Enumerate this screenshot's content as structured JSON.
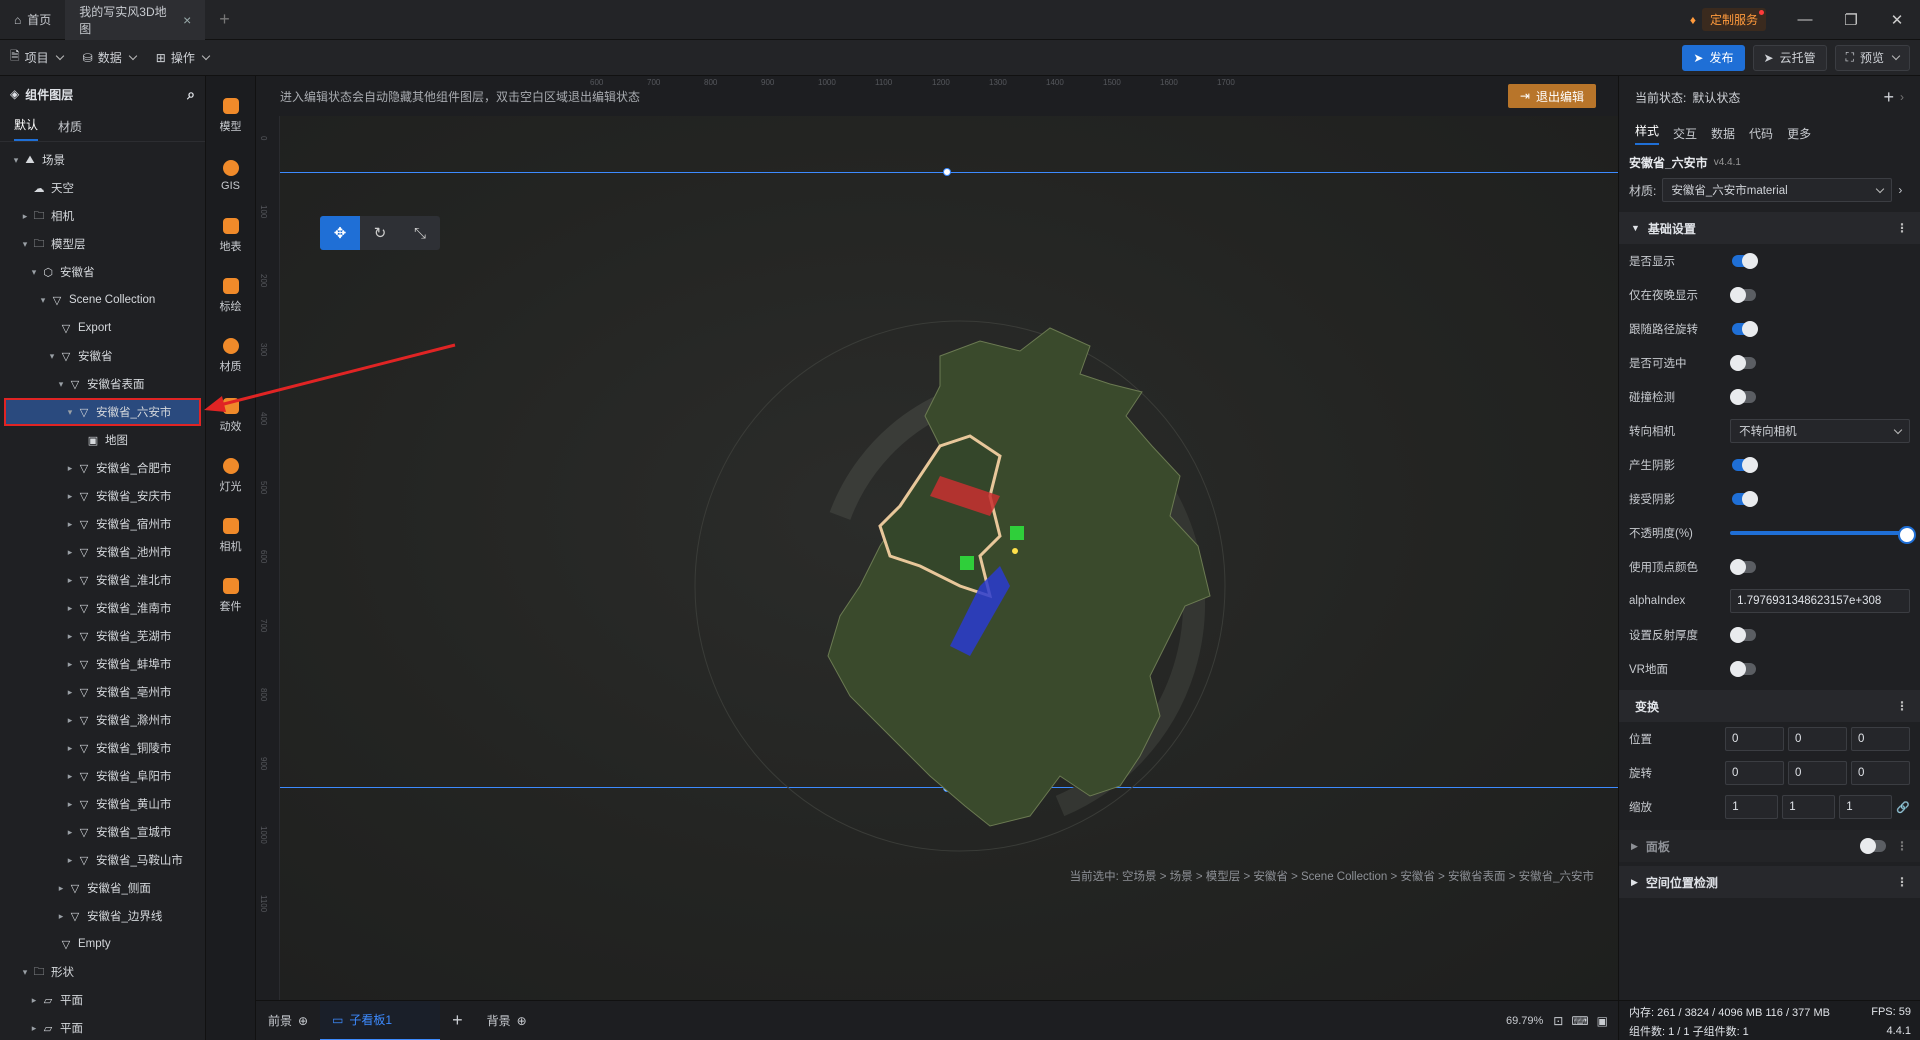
{
  "titlebar": {
    "home_tab": "首页",
    "doc_tab": "我的写实风3D地图",
    "custom_service": "定制服务"
  },
  "toolbar": {
    "menus": [
      "项目",
      "数据",
      "操作"
    ],
    "publish": "发布",
    "cloud_host": "云托管",
    "preview": "预览"
  },
  "left_panel": {
    "title": "组件图层",
    "tabs": [
      "默认",
      "材质"
    ],
    "tree": [
      {
        "label": "场景",
        "level": 0,
        "arrow": "▾",
        "icon": "⛰"
      },
      {
        "label": "天空",
        "level": 1,
        "arrow": "",
        "icon": "☁"
      },
      {
        "label": "相机",
        "level": 1,
        "arrow": "▸",
        "icon": "🗀"
      },
      {
        "label": "模型层",
        "level": 1,
        "arrow": "▾",
        "icon": "🗀"
      },
      {
        "label": "安徽省",
        "level": 2,
        "arrow": "▾",
        "icon": "⬡"
      },
      {
        "label": "Scene Collection",
        "level": 3,
        "arrow": "▾",
        "icon": "▽"
      },
      {
        "label": "Export",
        "level": 4,
        "arrow": "",
        "icon": "▽"
      },
      {
        "label": "安徽省",
        "level": 4,
        "arrow": "▾",
        "icon": "▽"
      },
      {
        "label": "安徽省表面",
        "level": 5,
        "arrow": "▾",
        "icon": "▽"
      },
      {
        "label": "安徽省_六安市",
        "level": 6,
        "arrow": "▾",
        "icon": "▽",
        "selected": true
      },
      {
        "label": "地图",
        "level": 7,
        "arrow": "",
        "icon": "▣"
      },
      {
        "label": "安徽省_合肥市",
        "level": 6,
        "arrow": "▸",
        "icon": "▽"
      },
      {
        "label": "安徽省_安庆市",
        "level": 6,
        "arrow": "▸",
        "icon": "▽"
      },
      {
        "label": "安徽省_宿州市",
        "level": 6,
        "arrow": "▸",
        "icon": "▽"
      },
      {
        "label": "安徽省_池州市",
        "level": 6,
        "arrow": "▸",
        "icon": "▽"
      },
      {
        "label": "安徽省_淮北市",
        "level": 6,
        "arrow": "▸",
        "icon": "▽"
      },
      {
        "label": "安徽省_淮南市",
        "level": 6,
        "arrow": "▸",
        "icon": "▽"
      },
      {
        "label": "安徽省_芜湖市",
        "level": 6,
        "arrow": "▸",
        "icon": "▽"
      },
      {
        "label": "安徽省_蚌埠市",
        "level": 6,
        "arrow": "▸",
        "icon": "▽"
      },
      {
        "label": "安徽省_亳州市",
        "level": 6,
        "arrow": "▸",
        "icon": "▽"
      },
      {
        "label": "安徽省_滁州市",
        "level": 6,
        "arrow": "▸",
        "icon": "▽"
      },
      {
        "label": "安徽省_铜陵市",
        "level": 6,
        "arrow": "▸",
        "icon": "▽"
      },
      {
        "label": "安徽省_阜阳市",
        "level": 6,
        "arrow": "▸",
        "icon": "▽"
      },
      {
        "label": "安徽省_黄山市",
        "level": 6,
        "arrow": "▸",
        "icon": "▽"
      },
      {
        "label": "安徽省_宣城市",
        "level": 6,
        "arrow": "▸",
        "icon": "▽"
      },
      {
        "label": "安徽省_马鞍山市",
        "level": 6,
        "arrow": "▸",
        "icon": "▽"
      },
      {
        "label": "安徽省_侧面",
        "level": 5,
        "arrow": "▸",
        "icon": "▽"
      },
      {
        "label": "安徽省_边界线",
        "level": 5,
        "arrow": "▸",
        "icon": "▽"
      },
      {
        "label": "Empty",
        "level": 4,
        "arrow": "",
        "icon": "▽"
      },
      {
        "label": "形状",
        "level": 1,
        "arrow": "▾",
        "icon": "🗀"
      },
      {
        "label": "平面",
        "level": 2,
        "arrow": "▸",
        "icon": "▱"
      },
      {
        "label": "平面",
        "level": 2,
        "arrow": "▸",
        "icon": "▱"
      }
    ]
  },
  "tools": [
    {
      "label": "模型",
      "icon": "model-icon"
    },
    {
      "label": "GIS",
      "icon": "gis-icon"
    },
    {
      "label": "地表",
      "icon": "terrain-icon"
    },
    {
      "label": "标绘",
      "icon": "marker-icon"
    },
    {
      "label": "材质",
      "icon": "material-icon"
    },
    {
      "label": "动效",
      "icon": "effect-icon"
    },
    {
      "label": "灯光",
      "icon": "light-icon"
    },
    {
      "label": "相机",
      "icon": "camera-icon"
    },
    {
      "label": "套件",
      "icon": "kit-icon"
    }
  ],
  "canvas": {
    "hint": "进入编辑状态会自动隐藏其他组件图层，双击空白区域退出编辑状态",
    "exit_edit": "退出编辑",
    "ruler_top": [
      "600",
      "700",
      "800",
      "900",
      "1000",
      "1100",
      "1200",
      "1300",
      "1400",
      "1500",
      "1600",
      "1700"
    ],
    "ruler_left": [
      "0",
      "100",
      "200",
      "300",
      "400",
      "500",
      "600",
      "700",
      "800",
      "900",
      "1000",
      "1100"
    ],
    "breadcrumb": "当前选中: 空场景 > 场景 > 模型层 > 安徽省 > Scene Collection > 安徽省 > 安徽省表面 > 安徽省_六安市"
  },
  "bottombar": {
    "foreground": "前景",
    "sub_panel": "子看板1",
    "background": "背景",
    "zoom": "69.79%"
  },
  "right_panel": {
    "state_label": "当前状态:",
    "state_value": "默认状态",
    "tabs": [
      "样式",
      "交互",
      "数据",
      "代码",
      "更多"
    ],
    "component_name": "安徽省_六安市",
    "version": "v4.4.1",
    "material_label": "材质:",
    "material_value": "安徽省_六安市material",
    "basic_section": "基础设置",
    "props": {
      "visible": {
        "label": "是否显示",
        "on": true
      },
      "night_only": {
        "label": "仅在夜晚显示",
        "on": false
      },
      "follow_path": {
        "label": "跟随路径旋转",
        "on": true
      },
      "selectable": {
        "label": "是否可选中",
        "on": false
      },
      "collision": {
        "label": "碰撞检测",
        "on": false
      },
      "face_camera": {
        "label": "转向相机",
        "value": "不转向相机"
      },
      "cast_shadow": {
        "label": "产生阴影",
        "on": true
      },
      "receive_shadow": {
        "label": "接受阴影",
        "on": true
      },
      "opacity": {
        "label": "不透明度(%)",
        "value": 100
      },
      "vertex_color": {
        "label": "使用顶点颜色",
        "on": false
      },
      "alpha_index": {
        "label": "alphaIndex",
        "value": "1.7976931348623157e+308"
      },
      "reflect_thickness": {
        "label": "设置反射厚度",
        "on": false
      },
      "vr_map": {
        "label": "VR地面",
        "on": false
      }
    },
    "transform_section": "变换",
    "position": {
      "label": "位置",
      "x": "0",
      "y": "0",
      "z": "0"
    },
    "rotation": {
      "label": "旋转",
      "x": "0",
      "y": "0",
      "z": "0"
    },
    "scale": {
      "label": "缩放",
      "x": "1",
      "y": "1",
      "z": "1"
    },
    "panel_section": "面板",
    "spatial_section": "空间位置检测",
    "status": {
      "memory": "内存: 261 / 3824 / 4096 MB 116 / 377 MB",
      "fps": "FPS: 59",
      "components": "组件数: 1 / 1   子组件数: 1",
      "version": "4.4.1"
    }
  }
}
